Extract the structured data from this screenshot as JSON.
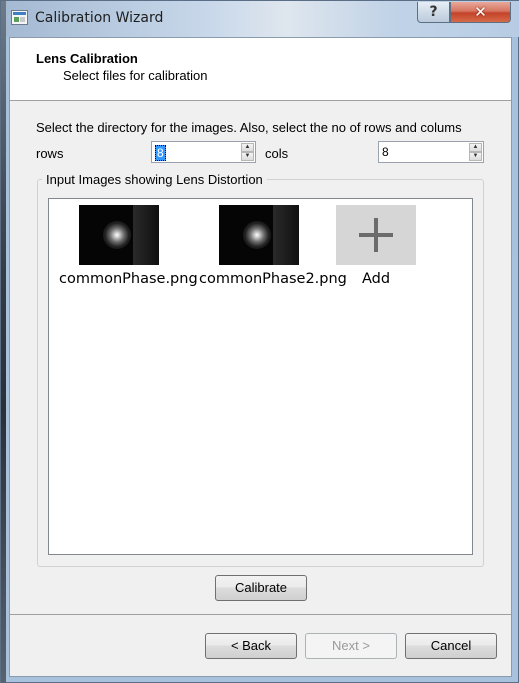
{
  "window": {
    "title": "Calibration Wizard",
    "help_symbol": "?",
    "close_symbol": "✕"
  },
  "header": {
    "title": "Lens Calibration",
    "subtitle": "Select files for calibration"
  },
  "form": {
    "instruction": "Select the directory for the images. Also, select the no of rows and colums",
    "rows_label": "rows",
    "rows_value": "8",
    "cols_label": "cols",
    "cols_value": "8"
  },
  "images_group": {
    "title": "Input Images showing Lens Distortion",
    "items": [
      {
        "label": "commonPhase.png"
      },
      {
        "label": "commonPhase2.png"
      }
    ],
    "add_label": "Add"
  },
  "buttons": {
    "calibrate": "Calibrate",
    "back": "< Back",
    "next": "Next >",
    "cancel": "Cancel"
  },
  "colors": {
    "titlebar": "#b9d1ea",
    "close_button": "#c4432a",
    "dialog_bg": "#f0f0f0"
  }
}
